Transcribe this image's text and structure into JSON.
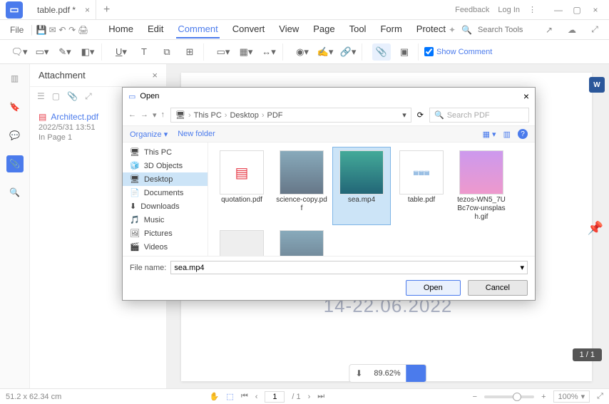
{
  "titlebar": {
    "tab_title": "table.pdf *",
    "feedback": "Feedback",
    "login": "Log In"
  },
  "menubar": {
    "file": "File",
    "items": [
      "Home",
      "Edit",
      "Comment",
      "Convert",
      "View",
      "Page",
      "Tool",
      "Form",
      "Protect"
    ],
    "active_index": 2,
    "search_placeholder": "Search Tools"
  },
  "toolbar": {
    "show_comment": "Show Comment"
  },
  "attachment_panel": {
    "title": "Attachment",
    "item": {
      "name": "Architect.pdf",
      "date": "2022/5/31 13:51",
      "page": "In Page 1"
    }
  },
  "document": {
    "date_text": "14-22.06.2022",
    "page_indicator": "1 / 1",
    "zoom_pct": "89.62%"
  },
  "dialog": {
    "title": "Open",
    "breadcrumb": [
      "This PC",
      "Desktop",
      "PDF"
    ],
    "search_placeholder": "Search PDF",
    "organize": "Organize",
    "new_folder": "New folder",
    "tree": [
      {
        "label": "This PC",
        "icon": "pc"
      },
      {
        "label": "3D Objects",
        "icon": "3d"
      },
      {
        "label": "Desktop",
        "icon": "desktop",
        "selected": true
      },
      {
        "label": "Documents",
        "icon": "doc"
      },
      {
        "label": "Downloads",
        "icon": "dl"
      },
      {
        "label": "Music",
        "icon": "music"
      },
      {
        "label": "Pictures",
        "icon": "pic"
      },
      {
        "label": "Videos",
        "icon": "vid"
      }
    ],
    "files": [
      {
        "name": "quotation.pdf",
        "thumb": "PDF"
      },
      {
        "name": "science-copy.pdf",
        "thumb": "IMG"
      },
      {
        "name": "sea.mp4",
        "thumb": "VID",
        "selected": true
      },
      {
        "name": "table.pdf",
        "thumb": "TBL"
      },
      {
        "name": "tezos-WN5_7UBc7cw-unsplash.gif",
        "thumb": "GIF"
      }
    ],
    "file_name_label": "File name:",
    "file_name_value": "sea.mp4",
    "open_btn": "Open",
    "cancel_btn": "Cancel"
  },
  "statusbar": {
    "dimensions": "51.2 x 62.34 cm",
    "current_page": "1",
    "total_pages": "/ 1",
    "zoom": "100%"
  }
}
